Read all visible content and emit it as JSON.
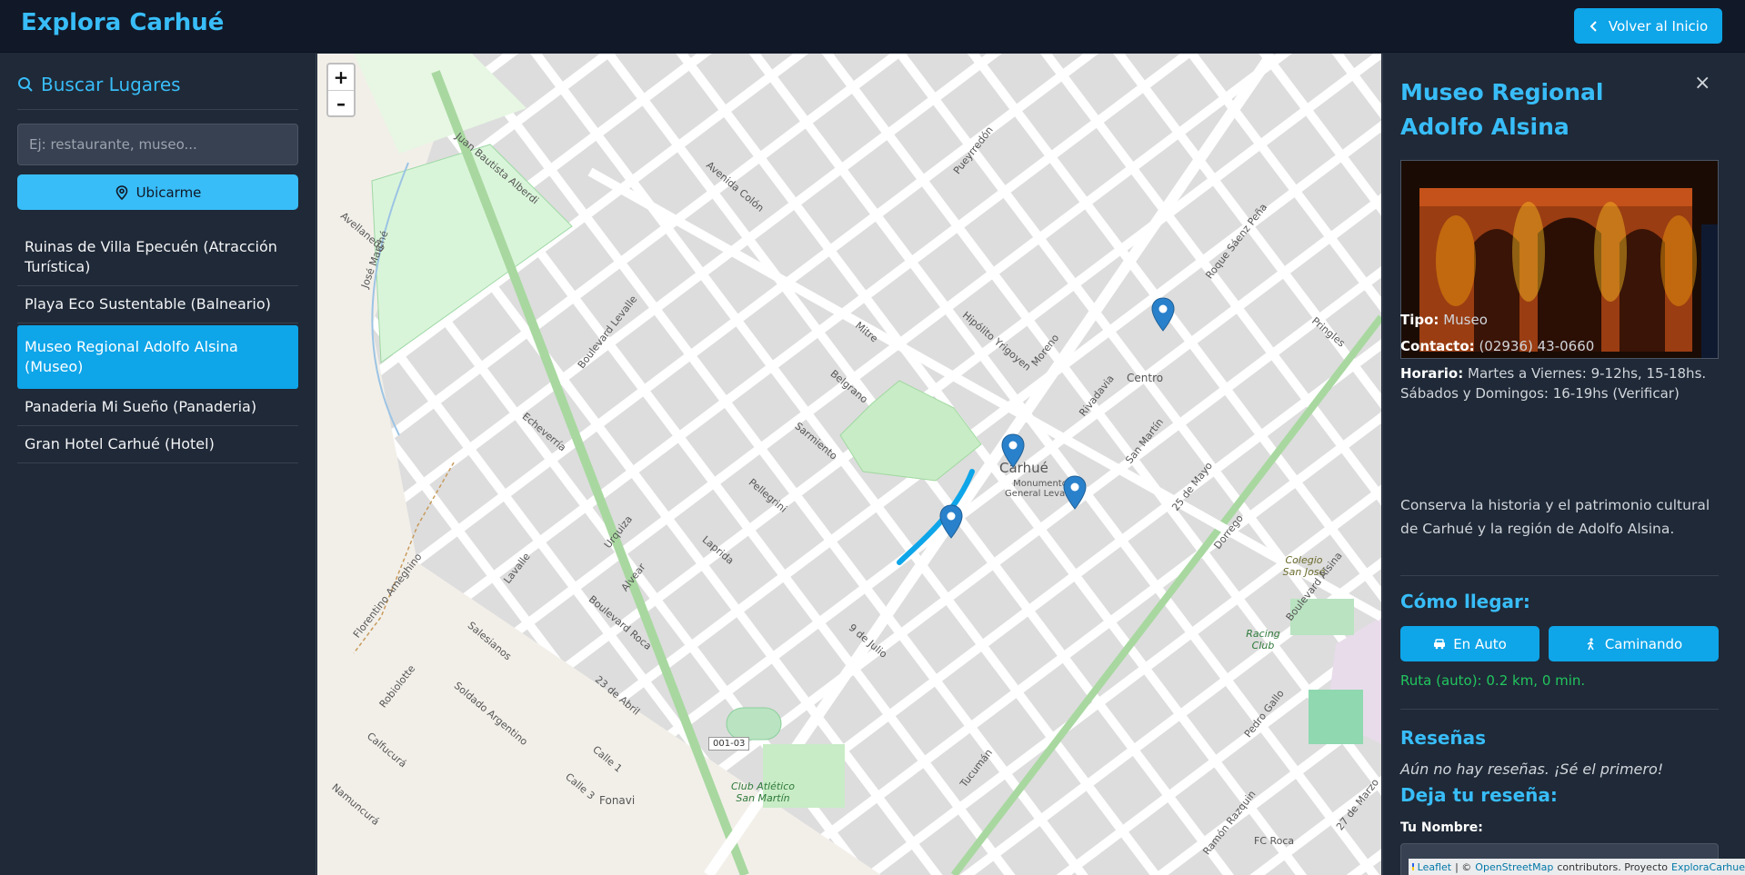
{
  "header": {
    "brand": "Explora Carhué",
    "back_label": "Volver al Inicio"
  },
  "sidebar": {
    "search_title": "Buscar Lugares",
    "search_placeholder": "Ej: restaurante, museo...",
    "locate_label": "Ubicarme",
    "places": [
      {
        "label": "Ruinas de Villa Epecuén (Atracción Turística)",
        "active": false
      },
      {
        "label": "Playa Eco Sustentable (Balneario)",
        "active": false
      },
      {
        "label": "Museo Regional Adolfo Alsina (Museo)",
        "active": true
      },
      {
        "label": "Panaderia Mi Sueño (Panaderia)",
        "active": false
      },
      {
        "label": "Gran Hotel Carhué (Hotel)",
        "active": false
      }
    ]
  },
  "map": {
    "zoom_in": "+",
    "zoom_out": "–",
    "labels": {
      "centro": "Centro",
      "carhue": "Carhué",
      "monumento": "Monumento General Levalle",
      "club_atletico": "Club Atlético San Martín",
      "colegio": "Colegio San José",
      "racing": "Racing Club",
      "fonavi": "Fonavi",
      "route_badge": "001-03",
      "fc_roca": "FC Roca"
    },
    "streets": [
      "Mitre",
      "Belgrano",
      "Sarmiento",
      "Pellegrini",
      "Laprida",
      "Moreno",
      "Rivadavia",
      "San Martín",
      "25 de Mayo",
      "Dorrego",
      "Avenida Colón",
      "Hipólito Yrigoyen",
      "Boulevard Levalle",
      "Boulevard Roca",
      "Avellaneda",
      "Roque Sáenz Peña",
      "Echeverría",
      "Juan Bautista Alberdi",
      "Robiolotte",
      "Florentino Ameghino",
      "Lavalle",
      "Urquiza",
      "Alvear",
      "Tucumán",
      "Pueyrredón",
      "Pringles",
      "Soldado Argentino",
      "Salesianos",
      "Calfucurá",
      "Namuncurá",
      "José Marché",
      "Boulevard Alsina",
      "Pedro Gallo",
      "9 de Julio",
      "23 de Abril",
      "27 de Marzo",
      "Ramón Razquin",
      "Calle 1",
      "Calle 3"
    ],
    "attribution": {
      "leaflet": "Leaflet",
      "osm": "OpenStreetMap",
      "contrib": "contributors. Proyecto",
      "project": "ExploraCarhue"
    }
  },
  "detail": {
    "close": "×",
    "title": "Museo Regional Adolfo Alsina",
    "tipo_label": "Tipo:",
    "tipo": "Museo",
    "contacto_label": "Contacto:",
    "contacto": "(02936) 43-0660",
    "horario_label": "Horario:",
    "horario": "Martes a Viernes: 9-12hs, 15-18hs. Sábados y Domingos: 16-19hs (Verificar)",
    "description": "Conserva la historia y el patrimonio cultural de Carhué y la región de Adolfo Alsina.",
    "como_llegar": "Cómo llegar:",
    "en_auto": "En Auto",
    "caminando": "Caminando",
    "route_info": "Ruta (auto): 0.2 km, 0 min.",
    "resenas": "Reseñas",
    "no_reviews": "Aún no hay reseñas. ¡Sé el primero!",
    "deja_resena": "Deja tu reseña:",
    "name_label": "Tu Nombre:"
  },
  "colors": {
    "accent": "#38bdf8",
    "button": "#0ea5e9",
    "header_bg": "#111827",
    "panel_bg": "#1f2937",
    "route_ok": "#22c55e",
    "map_bg": "#f2efe9",
    "block": "#dddddd"
  }
}
